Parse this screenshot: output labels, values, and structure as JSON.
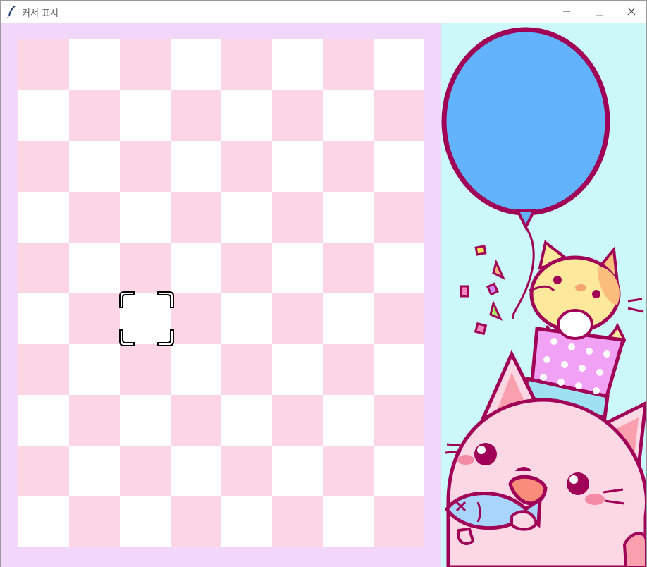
{
  "window": {
    "title": "커서 표시",
    "icons": {
      "app": "feather-icon",
      "minimize": "minimize-icon",
      "maximize": "maximize-icon",
      "close": "close-icon"
    }
  },
  "board": {
    "rows": 10,
    "cols": 8,
    "colors": {
      "frame": "#f2d7fb",
      "pink": "#fdd6e6",
      "white": "#ffffff"
    },
    "cursor": {
      "row": 5,
      "col": 2,
      "color": "#000000"
    }
  },
  "decoration": {
    "background": "#cdf8fa",
    "balloon": "#62b3fb",
    "outline": "#a10057",
    "items": [
      "balloon",
      "yellow-cat",
      "party-hat",
      "pink-cat",
      "fish",
      "confetti"
    ]
  }
}
